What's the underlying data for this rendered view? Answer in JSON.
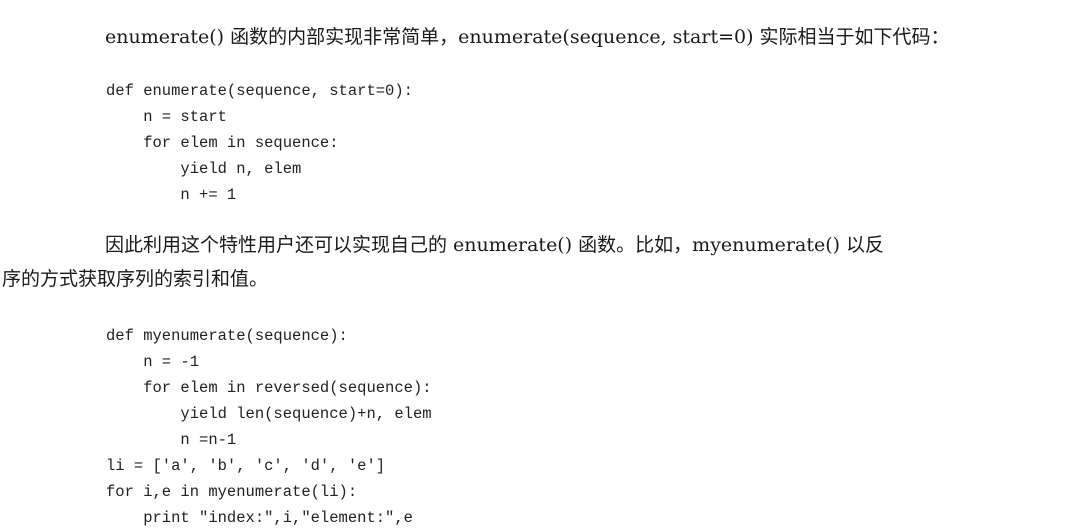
{
  "paragraphs": [
    "enumerate() 函数的内部实现非常简单，enumerate(sequence, start=0) 实际相当于如下代码：",
    "因此利用这个特性用户还可以实现自己的 enumerate() 函数。比如，myenumerate() 以反",
    "序的方式获取序列的索引和值。"
  ],
  "code_blocks": [
    {
      "lines": [
        "def enumerate(sequence, start=0):",
        "    n = start",
        "    for elem in sequence:",
        "        yield n, elem",
        "        n += 1"
      ]
    },
    {
      "lines": [
        "def myenumerate(sequence):",
        "    n = -1",
        "    for elem in reversed(sequence):",
        "        yield len(sequence)+n, elem",
        "        n =n-1",
        "li = ['a', 'b', 'c', 'd', 'e']",
        "for i,e in myenumerate(li):",
        "    print \"index:\",i,\"element:\",e"
      ]
    }
  ]
}
